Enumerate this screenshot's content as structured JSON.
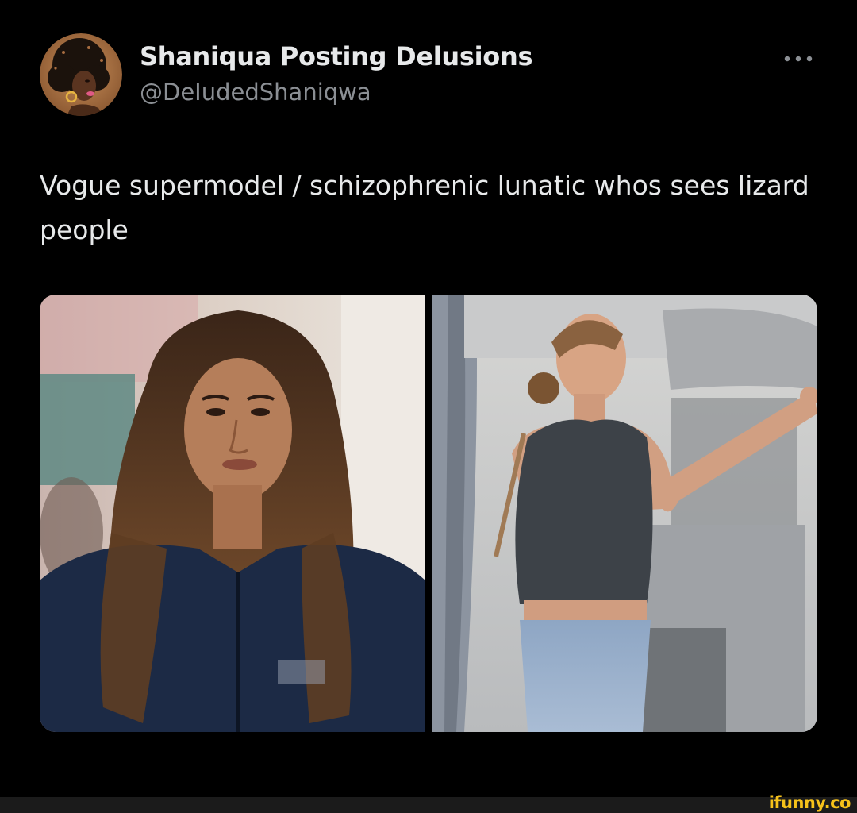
{
  "author": {
    "display_name": "Shaniqua Posting Delusions",
    "handle": "@DeIudedShaniqwa",
    "avatar_icon": "profile-avatar"
  },
  "header": {
    "more_icon": "more-options-icon",
    "more_glyph": "•••"
  },
  "tweet": {
    "text": "Vogue supermodel / schizophrenic lunatic whos sees lizard people"
  },
  "media": {
    "count": 2,
    "items": [
      {
        "subject": "woman-with-long-curly-hair-portrait"
      },
      {
        "subject": "woman-on-airplane-pointing"
      }
    ]
  },
  "footer": {
    "watermark": "ifunny.co"
  },
  "colors": {
    "background": "#000000",
    "text_primary": "#e7e9ea",
    "text_secondary": "#8b8f94",
    "footer_bar": "#1b1b1b",
    "watermark": "#f5c11a"
  }
}
